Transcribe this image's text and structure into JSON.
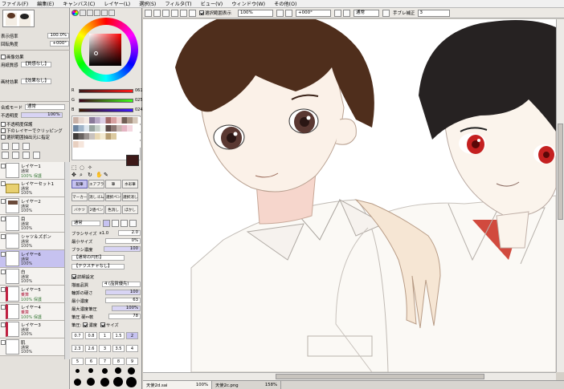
{
  "menu": [
    "ファイル(F)",
    "編集(E)",
    "キャンバス(C)",
    "レイヤー(L)",
    "選択(S)",
    "フィルタ(T)",
    "ビュー(V)",
    "ウィンドウ(W)",
    "その他(O)"
  ],
  "toolbar": {
    "show_selection_label": "選択範囲表示",
    "zoom": "100%",
    "angle": "+000°",
    "mode": "通常",
    "stabilizer_label": "手ブレ補正",
    "stabilizer_value": "3"
  },
  "left_panel": {
    "zoom_label": "表示倍率",
    "zoom_value": "100.0%",
    "angle_label": "回転角度",
    "angle_value": "+000°",
    "effects_header": "画像効果",
    "texture_label": "用紙質感",
    "texture_value": "【質感なし】",
    "effect_label": "画材効果",
    "effect_value": "【効果なし】",
    "blend_label": "合成モード",
    "blend_value": "通常",
    "opacity_label": "不透明度",
    "opacity_value": "100%",
    "protect_label": "不透明度保護",
    "clip_label": "下のレイヤーでクリッピング",
    "select_source_label": "選択範囲抽出元に指定",
    "layers": [
      {
        "name": "レイヤー1",
        "mode": "通常",
        "opacity": "100% 保護",
        "selected": false
      },
      {
        "name": "レイヤーセット1",
        "mode": "通常",
        "opacity": "100%",
        "selected": false
      },
      {
        "name": "レイヤー2",
        "mode": "通常",
        "opacity": "100%",
        "selected": false
      },
      {
        "name": "目",
        "mode": "通常",
        "opacity": "100%",
        "selected": false
      },
      {
        "name": "シャツ＆ズボン",
        "mode": "通常",
        "opacity": "100%",
        "selected": false
      },
      {
        "name": "レイヤー6",
        "mode": "通常",
        "opacity": "100%",
        "selected": true
      },
      {
        "name": "白",
        "mode": "通常",
        "opacity": "100%",
        "selected": false
      },
      {
        "name": "レイヤー5",
        "mode": "乗算",
        "opacity": "100% 保護",
        "selected": false
      },
      {
        "name": "レイヤー4",
        "mode": "乗算",
        "opacity": "100% 保護",
        "selected": false
      },
      {
        "name": "レイヤー3",
        "mode": "通常",
        "opacity": "100%",
        "selected": false
      },
      {
        "name": "肌",
        "mode": "通常",
        "opacity": "100%",
        "selected": false
      }
    ]
  },
  "tool_panel": {
    "sliders": [
      {
        "label": "R",
        "value": "061",
        "color": "#e03030"
      },
      {
        "label": "G",
        "value": "025",
        "color": "#30c030"
      },
      {
        "label": "B",
        "value": "024",
        "color": "#3040e0"
      }
    ],
    "current_color": "#3d1918",
    "tools": [
      [
        "鉛筆",
        "エアブラシ",
        "筆",
        "水彩筆"
      ],
      [
        "マーカー",
        "消しゴム",
        "選択ペン",
        "選択消し"
      ],
      [
        "バケツ",
        "2値ペン",
        "色消し",
        "ぼかし"
      ]
    ],
    "blend_mode": "通常",
    "brush_size_label": "ブラシサイズ",
    "brush_size_mult": "x1.0",
    "brush_size_value": "2.0",
    "min_size_label": "最小サイズ",
    "min_size_value": "0%",
    "density_label": "ブラシ濃度",
    "density_value": "100",
    "shape_value": "【通常の円形】",
    "texture_value": "【テクスチャなし】",
    "detail_label": "詳細設定",
    "quality_label": "描画品質",
    "quality_value": "4 (品質優先)",
    "edge_label": "輪郭の硬さ",
    "edge_value": "100",
    "min_density_label": "最小濃度",
    "min_density_value": "63",
    "max_density_label": "最大濃度筆圧",
    "max_density_value": "100%",
    "pressure_label": "筆圧 硬⇔軟",
    "pressure_value": "78",
    "pressure2_label": "筆圧:",
    "pressure_density_label": "濃度",
    "pressure_size_label": "サイズ",
    "brush_sizes": [
      "0.7",
      "0.8",
      "1",
      "1.5",
      "2",
      "2.3",
      "2.6",
      "3",
      "3.5",
      "4",
      "5",
      "6",
      "7",
      "8",
      "9"
    ]
  },
  "tabs": [
    {
      "name": "天使2d.sai",
      "zoom": "100%"
    },
    {
      "name": "天使2c.png",
      "zoom": "158%"
    }
  ]
}
